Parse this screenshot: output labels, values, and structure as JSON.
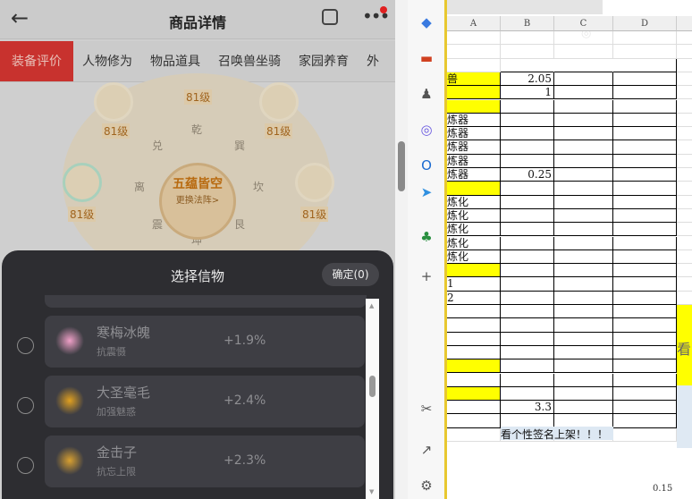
{
  "phone": {
    "title": "商品详情",
    "tabs": [
      "装备评价",
      "人物修为",
      "物品道具",
      "召唤兽坐骑",
      "家园养育",
      "外"
    ],
    "active_tab": 0,
    "art": {
      "center_title": "五蕴皆空",
      "center_sub": "更换法阵>",
      "level_label": "81级",
      "trigrams": [
        "乾",
        "巽",
        "坎",
        "艮",
        "坤",
        "震",
        "离",
        "兑"
      ]
    },
    "sheet": {
      "title": "选择信物",
      "confirm": "确定(0)",
      "items": [
        {
          "name": "寒梅冰魄",
          "sub": "抗震慑",
          "value": "+1.9%",
          "icon": "plum-blossom-icon",
          "color": "#f0a0c8"
        },
        {
          "name": "大圣毫毛",
          "sub": "加强魅惑",
          "value": "+2.4%",
          "icon": "golden-hair-icon",
          "color": "#e0a020"
        },
        {
          "name": "金击子",
          "sub": "抗忘上限",
          "value": "+2.3%",
          "icon": "golden-scepter-icon",
          "color": "#d8a030"
        }
      ]
    }
  },
  "sidebar_icons": [
    "tag-icon",
    "toolbox-icon",
    "chess-icon",
    "copilot-icon",
    "outlook-icon",
    "send-icon",
    "tree-icon",
    "plus-icon",
    "screenshot-icon",
    "external-link-icon",
    "settings-icon"
  ],
  "sheet": {
    "columns": [
      "A",
      "B",
      "C",
      "D"
    ],
    "rows": [
      {
        "a": "",
        "b": ""
      },
      {
        "a": "",
        "b": ""
      },
      {
        "a": "",
        "b": "",
        "box": true
      },
      {
        "a": "兽",
        "b": "2.05",
        "y": true
      },
      {
        "a": "",
        "b": "1",
        "y": true
      },
      {
        "a": "",
        "b": "",
        "y": true
      },
      {
        "a": "炼器",
        "b": ""
      },
      {
        "a": "炼器",
        "b": ""
      },
      {
        "a": "炼器",
        "b": ""
      },
      {
        "a": "炼器",
        "b": ""
      },
      {
        "a": "炼器",
        "b": "0.25"
      },
      {
        "a": "",
        "b": "",
        "y": true
      },
      {
        "a": "炼化",
        "b": ""
      },
      {
        "a": "炼化",
        "b": ""
      },
      {
        "a": "炼化",
        "b": ""
      },
      {
        "a": "炼化",
        "b": ""
      },
      {
        "a": "炼化",
        "b": ""
      },
      {
        "a": "",
        "b": "",
        "y": true
      },
      {
        "a": "1",
        "b": ""
      },
      {
        "a": "2",
        "b": ""
      },
      {
        "a": "",
        "b": ""
      },
      {
        "a": "",
        "b": ""
      },
      {
        "a": "",
        "b": ""
      },
      {
        "a": "",
        "b": ""
      },
      {
        "a": "",
        "b": "",
        "y": true
      },
      {
        "a": "",
        "b": ""
      },
      {
        "a": "",
        "b": "",
        "y": true
      },
      {
        "a": "",
        "b": "3.3"
      },
      {
        "a": "",
        "b": ""
      },
      {
        "a": "",
        "b": ""
      }
    ],
    "e_text": "看",
    "sign_text": "看个性签名上架！！！",
    "footer_value": "0.15",
    "highlight_color": "#ffff00"
  }
}
